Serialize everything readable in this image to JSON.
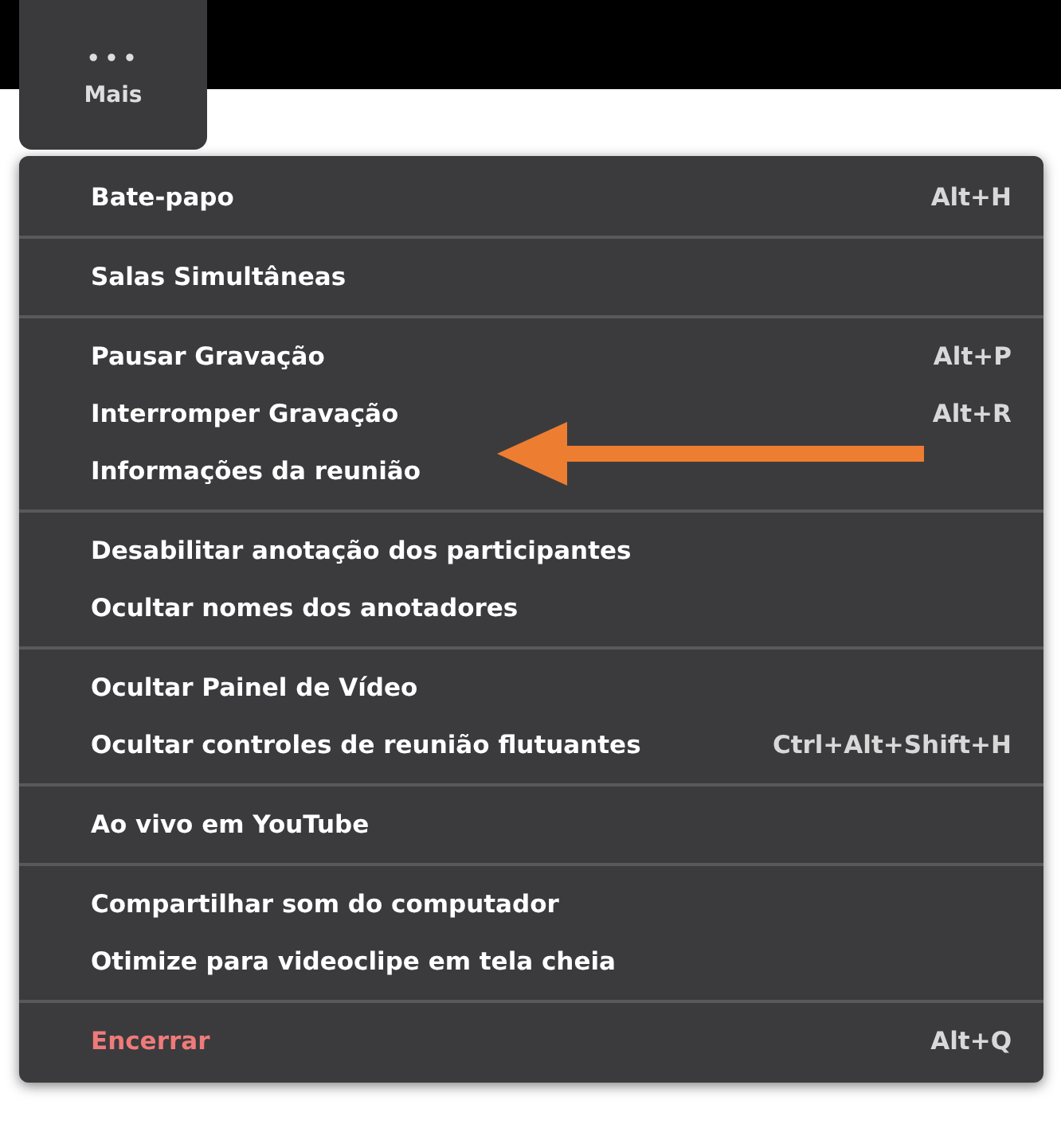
{
  "toolbar": {
    "more_button": {
      "icon": "•••",
      "label": "Mais"
    }
  },
  "menu": {
    "groups": [
      {
        "items": [
          {
            "label": "Bate-papo",
            "shortcut": "Alt+H",
            "kind": "normal"
          }
        ]
      },
      {
        "items": [
          {
            "label": "Salas Simultâneas",
            "kind": "normal"
          }
        ]
      },
      {
        "items": [
          {
            "label": "Pausar Gravação",
            "shortcut": "Alt+P",
            "kind": "normal"
          },
          {
            "label": "Interromper Gravação",
            "shortcut": "Alt+R",
            "kind": "normal"
          },
          {
            "label": "Informações da reunião",
            "kind": "normal"
          }
        ]
      },
      {
        "items": [
          {
            "label": "Desabilitar anotação dos participantes",
            "kind": "normal"
          },
          {
            "label": "Ocultar nomes dos anotadores",
            "kind": "normal"
          }
        ]
      },
      {
        "items": [
          {
            "label": "Ocultar Painel de Vídeo",
            "kind": "normal"
          },
          {
            "label": "Ocultar controles de reunião flutuantes",
            "shortcut": "Ctrl+Alt+Shift+H",
            "kind": "normal"
          }
        ]
      },
      {
        "items": [
          {
            "label": "Ao vivo em YouTube",
            "kind": "normal"
          }
        ]
      },
      {
        "items": [
          {
            "label": "Compartilhar som do computador",
            "kind": "normal"
          },
          {
            "label": "Otimize para videoclipe em tela cheia",
            "kind": "normal"
          }
        ]
      },
      {
        "items": [
          {
            "label": "Encerrar",
            "shortcut": "Alt+Q",
            "kind": "danger"
          }
        ]
      }
    ]
  }
}
